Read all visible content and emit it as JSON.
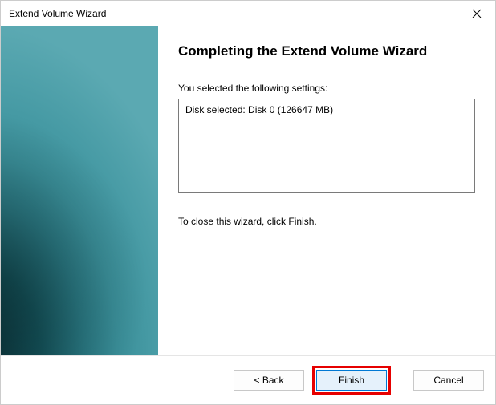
{
  "titlebar": {
    "title": "Extend Volume Wizard"
  },
  "content": {
    "heading": "Completing the Extend Volume Wizard",
    "settings_label": "You selected the following settings:",
    "settings_value": "Disk selected: Disk 0 (126647 MB)",
    "instruction": "To close this wizard, click Finish."
  },
  "footer": {
    "back_label": "< Back",
    "finish_label": "Finish",
    "cancel_label": "Cancel"
  }
}
